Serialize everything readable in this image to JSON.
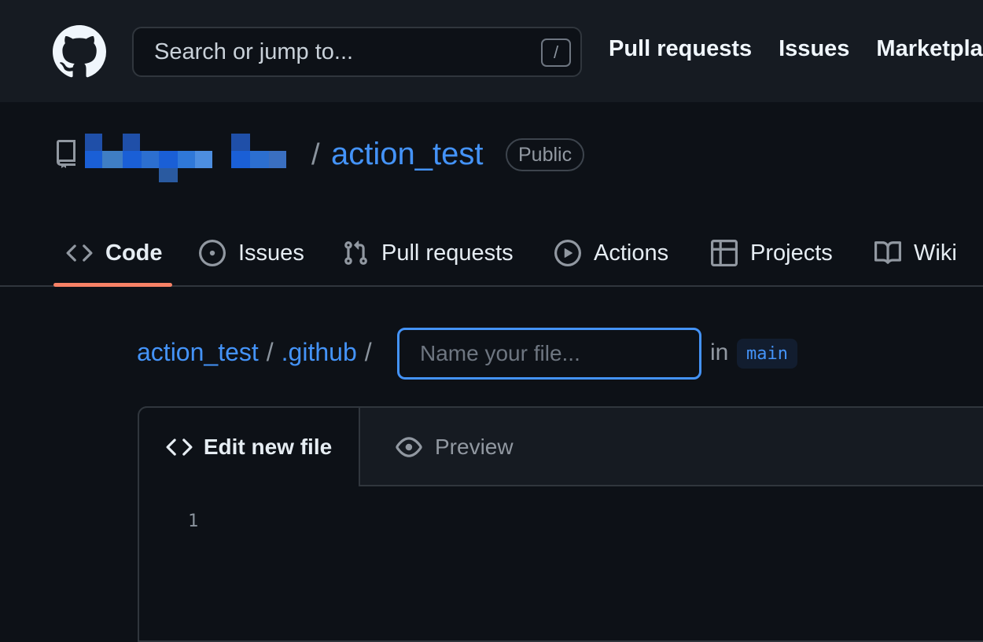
{
  "header": {
    "search_placeholder": "Search or jump to...",
    "search_shortcut": "/",
    "nav": [
      "Pull requests",
      "Issues",
      "Marketplace"
    ]
  },
  "repo": {
    "separator": "/",
    "name": "action_test",
    "visibility": "Public"
  },
  "tabs": [
    {
      "label": "Code",
      "icon": "code-icon",
      "active": true
    },
    {
      "label": "Issues",
      "icon": "issue-opened-icon"
    },
    {
      "label": "Pull requests",
      "icon": "git-pull-request-icon"
    },
    {
      "label": "Actions",
      "icon": "play-icon"
    },
    {
      "label": "Projects",
      "icon": "table-icon"
    },
    {
      "label": "Wiki",
      "icon": "book-icon"
    }
  ],
  "breadcrumb": {
    "repo": "action_test",
    "folder": ".github",
    "sep": "/",
    "filename_placeholder": "Name your file...",
    "in_label": "in",
    "branch": "main"
  },
  "editor": {
    "edit_tab": "Edit new file",
    "preview_tab": "Preview",
    "line_number": "1"
  },
  "colors": {
    "background": "#0d1117",
    "header_bg": "#161b22",
    "link": "#4493f8",
    "active_tab_underline": "#f78166"
  }
}
